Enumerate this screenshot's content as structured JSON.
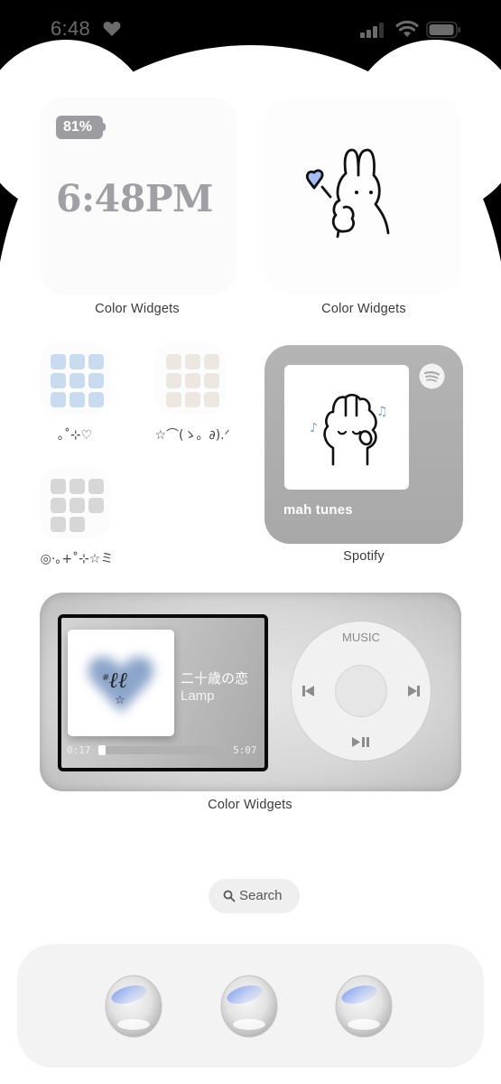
{
  "status_bar": {
    "time": "6:48",
    "heart_icon": "heart-icon",
    "signal_icon": "cellular-signal-icon",
    "wifi_icon": "wifi-icon",
    "battery_icon": "battery-icon"
  },
  "widgets": {
    "clock": {
      "battery_percent": "81%",
      "time": "6:48PM",
      "label": "Color Widgets"
    },
    "bunny": {
      "image": "bunny-with-heart-balloon-icon",
      "heart_color": "#a7bcf2",
      "label": "Color Widgets"
    },
    "spotify": {
      "playlist_title": "mah tunes",
      "cover": "bunny-listening-music-icon",
      "note_color": "#7aa3e0",
      "logo": "spotify-icon",
      "label": "Spotify"
    },
    "ipod": {
      "song_title": "二十歳の恋",
      "artist": "Lamp",
      "elapsed": "0:17",
      "duration": "5:07",
      "progress": 0.055,
      "wheel_menu": "MUSIC",
      "prev_icon": "skip-back-icon",
      "next_icon": "skip-forward-icon",
      "play_pause_icon": "play-pause-icon",
      "label": "Color Widgets"
    }
  },
  "apps": [
    {
      "label": "｡˚⊹♡",
      "grid_color": "#c9dbef",
      "tiles": 9
    },
    {
      "label": "☆⌒(ゝ。∂).ᐟ",
      "grid_color": "#ece8e1",
      "tiles": 9
    },
    {
      "label": "◎·｡+˚⊹☆ミ",
      "grid_color": "#d7d7d7",
      "tiles": 8
    }
  ],
  "search": {
    "label": "Search"
  },
  "dock": {
    "apps": [
      {
        "name": "dock-app-1",
        "icon": "pearl-bubble-icon"
      },
      {
        "name": "dock-app-2",
        "icon": "pearl-bubble-icon"
      },
      {
        "name": "dock-app-3",
        "icon": "pearl-bubble-icon"
      }
    ]
  }
}
